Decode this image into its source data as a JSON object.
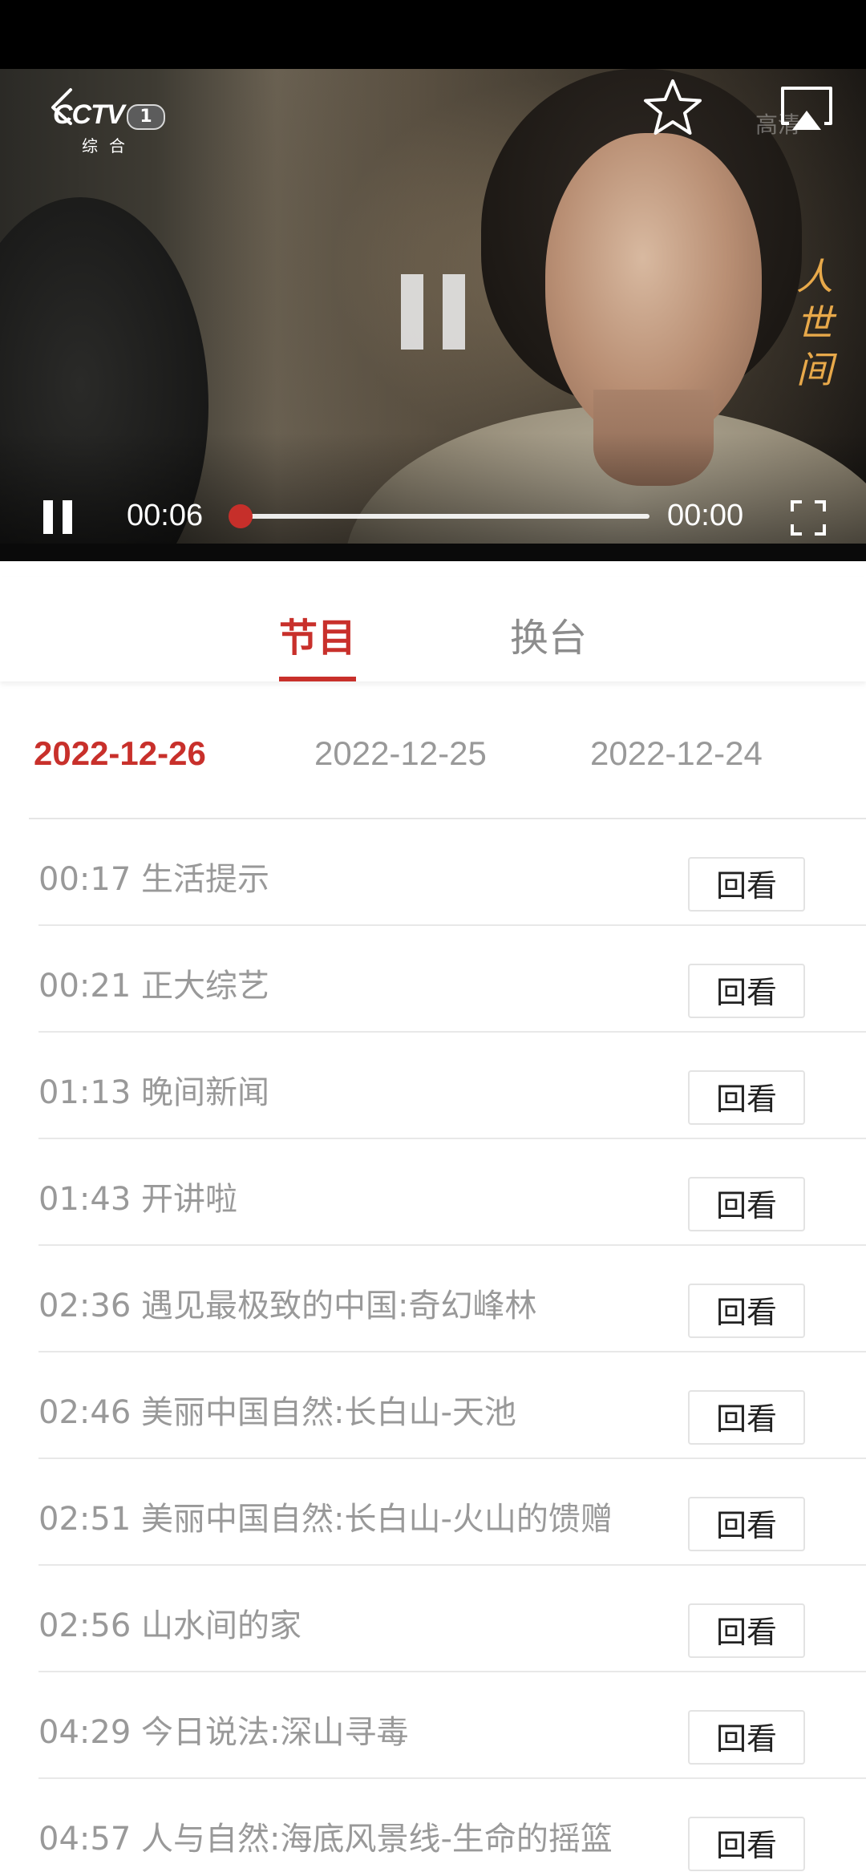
{
  "player": {
    "channel_logo_text": "CCTV",
    "channel_number": "1",
    "channel_sub": "综合",
    "hd_label": "高清",
    "show_title": "人世间",
    "time_current": "00:06",
    "time_total": "00:00",
    "progress": 0.0
  },
  "tabs": [
    {
      "label": "节目",
      "active": true
    },
    {
      "label": "换台",
      "active": false
    }
  ],
  "dates": [
    {
      "label": "2022-12-26",
      "active": true
    },
    {
      "label": "2022-12-25",
      "active": false
    },
    {
      "label": "2022-12-24",
      "active": false
    }
  ],
  "programs": [
    {
      "label": "00:17 生活提示",
      "button": "回看"
    },
    {
      "label": "00:21 正大综艺",
      "button": "回看"
    },
    {
      "label": "01:13 晚间新闻",
      "button": "回看"
    },
    {
      "label": "01:43 开讲啦",
      "button": "回看"
    },
    {
      "label": "02:36 遇见最极致的中国:奇幻峰林",
      "button": "回看"
    },
    {
      "label": "02:46 美丽中国自然:长白山-天池",
      "button": "回看"
    },
    {
      "label": "02:51 美丽中国自然:长白山-火山的馈赠",
      "button": "回看"
    },
    {
      "label": "02:56 山水间的家",
      "button": "回看"
    },
    {
      "label": "04:29 今日说法:深山寻毒",
      "button": "回看"
    },
    {
      "label": "04:57 人与自然:海底风景线-生命的摇篮",
      "button": "回看"
    }
  ],
  "colors": {
    "accent": "#c8302b",
    "inactive_text": "#999999"
  }
}
